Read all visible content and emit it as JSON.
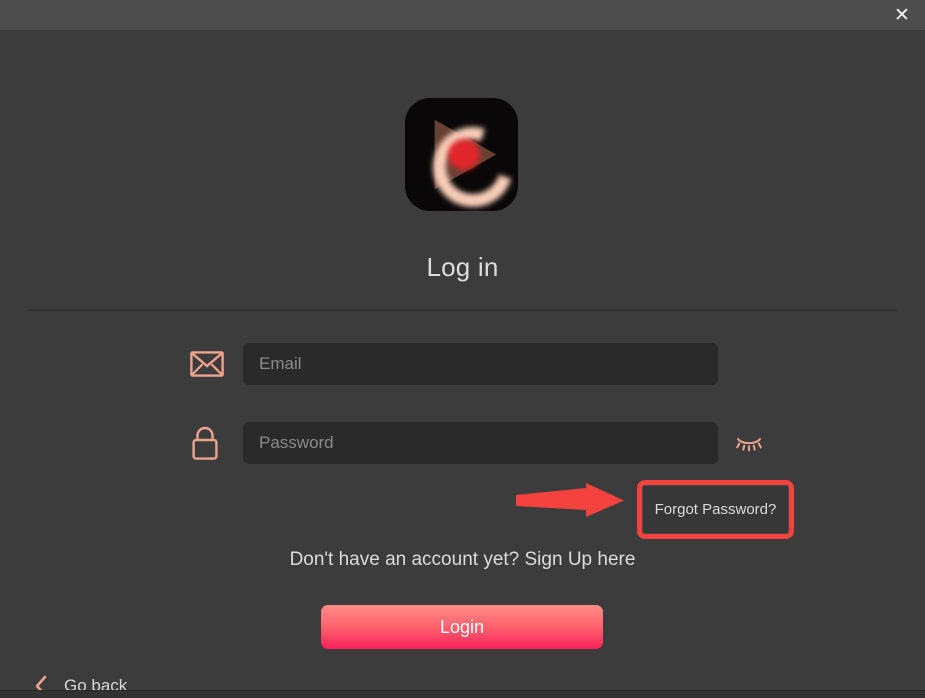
{
  "window": {
    "close_label": "✕",
    "title_bar_color": "#4e4d4d",
    "body_color": "#3d3c3c"
  },
  "branding": {
    "logo_icon": "app-play-logo",
    "logo_background": "#0a0708",
    "logo_triangle_color": "#6b4436",
    "logo_arc_color": "#f7cdb8",
    "logo_dot_color": "#e8262b"
  },
  "heading": {
    "title": "Log in"
  },
  "form": {
    "email": {
      "icon": "envelope-icon",
      "placeholder": "Email",
      "value": ""
    },
    "password": {
      "icon": "padlock-icon",
      "placeholder": "Password",
      "value": "",
      "toggle_icon": "eye-closed-icon"
    },
    "forgot_password_label": "Forgot Password?",
    "signup_text": "Don't have an account yet? Sign Up here",
    "login_label": "Login"
  },
  "footer": {
    "go_back_label": "Go back",
    "go_back_icon": "chevron-left-icon"
  },
  "annotation": {
    "arrow_color": "#f4433f",
    "highlight_color": "#f4433f",
    "target": "forgot-password-button"
  },
  "colors": {
    "accent_salmon": "#eda48f",
    "field_background": "#2b2a2a",
    "placeholder": "#8b8a8a",
    "text_primary": "#dcdcdc",
    "login_gradient_top": "#ff8d86",
    "login_gradient_bottom": "#f72159"
  }
}
